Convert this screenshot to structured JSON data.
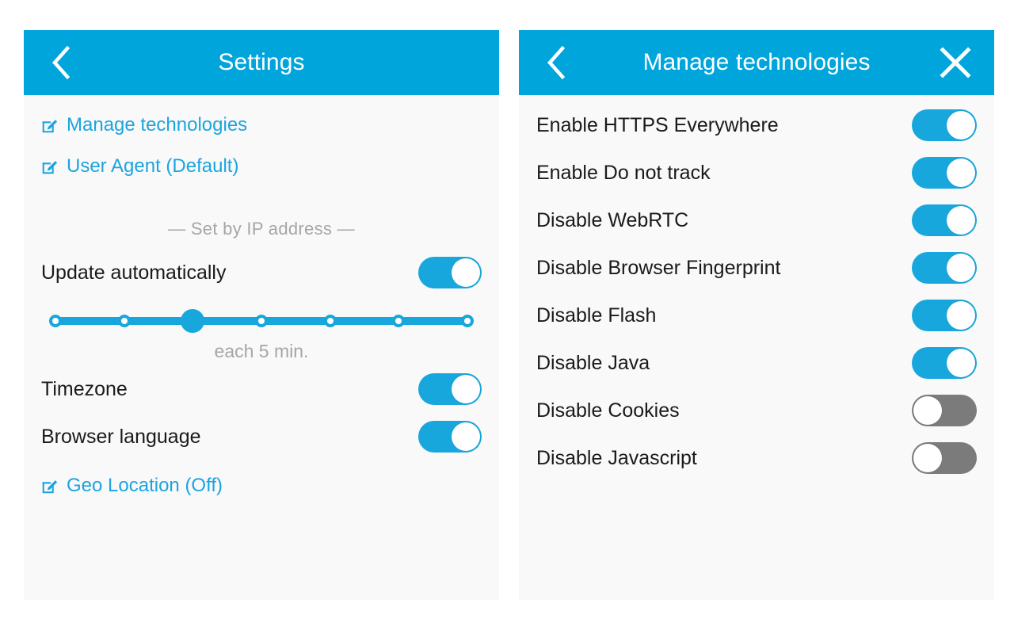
{
  "colors": {
    "accent": "#00a5dc",
    "toggle_on": "#17a7dd",
    "toggle_off": "#7b7b7b",
    "link": "#1ba4e0",
    "muted_text": "#a6a6a6",
    "panel_bg": "#f9f9f9",
    "text": "#1a1a1a"
  },
  "settings_panel": {
    "header": {
      "title": "Settings",
      "back_icon": "chevron-left-icon"
    },
    "links": [
      {
        "label": "Manage technologies",
        "icon": "edit-icon"
      },
      {
        "label": "User Agent (Default)",
        "icon": "edit-icon"
      }
    ],
    "section_divider": "— Set by IP address —",
    "update": {
      "label": "Update automatically",
      "enabled": true,
      "slider": {
        "stops": 7,
        "value_index": 2,
        "caption": "each 5 min."
      }
    },
    "toggles": [
      {
        "label": "Timezone",
        "enabled": true
      },
      {
        "label": "Browser language",
        "enabled": true
      }
    ],
    "footer_link": {
      "label": "Geo Location (Off)",
      "icon": "edit-icon"
    }
  },
  "technologies_panel": {
    "header": {
      "title": "Manage technologies",
      "back_icon": "chevron-left-icon",
      "close_icon": "close-icon"
    },
    "items": [
      {
        "label": "Enable HTTPS Everywhere",
        "enabled": true
      },
      {
        "label": "Enable Do not track",
        "enabled": true
      },
      {
        "label": "Disable WebRTC",
        "enabled": true
      },
      {
        "label": "Disable Browser Fingerprint",
        "enabled": true
      },
      {
        "label": "Disable Flash",
        "enabled": true
      },
      {
        "label": "Disable Java",
        "enabled": true
      },
      {
        "label": "Disable Cookies",
        "enabled": false
      },
      {
        "label": "Disable Javascript",
        "enabled": false
      }
    ]
  }
}
